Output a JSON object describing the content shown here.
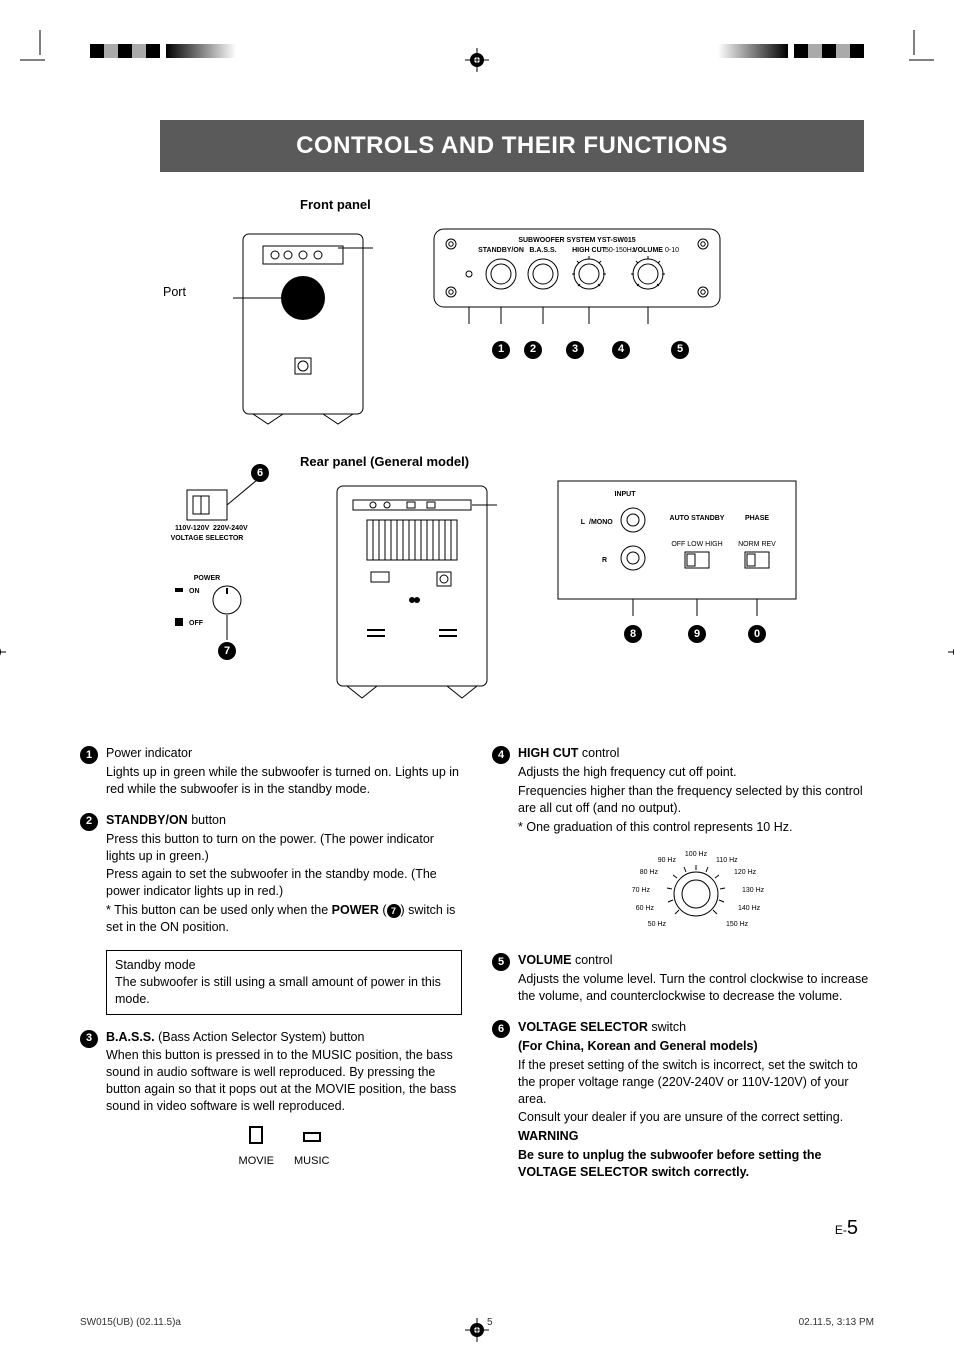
{
  "title": "CONTROLS AND THEIR FUNCTIONS",
  "labels": {
    "front_panel": "Front panel",
    "rear_panel": "Rear panel (General model)",
    "port": "Port"
  },
  "front_panel_zoom": {
    "product": "SUBWOOFER SYSTEM YST-SW015",
    "knob_labels": [
      "STANDBY/ON",
      "B.A.S.S.",
      "HIGH CUT",
      "VOLUME"
    ],
    "high_cut_range": "50-150Hz",
    "volume_range": "0-10"
  },
  "rear_side": {
    "voltage_selector_caption": "VOLTAGE SELECTOR",
    "voltage_left": "110V-120V",
    "voltage_right": "220V-240V",
    "power_label": "POWER",
    "on_label": "ON",
    "off_label": "OFF"
  },
  "rear_panel_zoom": {
    "input_label": "INPUT",
    "mono_label": "/MONO",
    "auto_standby_label": "AUTO STANDBY",
    "auto_standby_opts": "OFF LOW HIGH",
    "phase_label": "PHASE",
    "phase_opts": "NORM REV"
  },
  "callouts_front": [
    "1",
    "2",
    "3",
    "4",
    "5"
  ],
  "callouts_rear_side": [
    "6",
    "7"
  ],
  "callouts_rear_panel": [
    "8",
    "9",
    "0"
  ],
  "items": {
    "1": {
      "title_plain": "Power indicator",
      "body": "Lights up in green while the subwoofer is turned on. Lights up in red while the subwoofer is in the standby mode."
    },
    "2": {
      "title_bold": "STANDBY/ON",
      "title_rest": " button",
      "body1": "Press this button to turn on the power. (The power indicator lights up in green.)",
      "body2": "Press again to set the subwoofer in the standby mode. (The power indicator lights up in red.)",
      "note_pre": "This button can be used only when the ",
      "note_bold": "POWER",
      "note_post1": " (",
      "note_ref": "7",
      "note_post2": ") switch is set in the ON position."
    },
    "standby_box": {
      "title": "Standby mode",
      "body": "The subwoofer is still using a small amount of power in this mode."
    },
    "3": {
      "title_bold": "B.A.S.S.",
      "title_rest": " (Bass Action Selector System) button",
      "body": "When this button is pressed in to the MUSIC position, the bass sound in audio software is well reproduced. By pressing the button again so that it pops out at the MOVIE position, the bass sound in video software is well reproduced.",
      "movie": "MOVIE",
      "music": "MUSIC"
    },
    "4": {
      "title_bold": "HIGH CUT",
      "title_rest": " control",
      "body1": "Adjusts the high frequency cut off point.",
      "body2": "Frequencies higher than the frequency selected by this control are all cut off (and no output).",
      "note": "One graduation of this control represents 10 Hz.",
      "dial_labels": [
        "50 Hz",
        "60 Hz",
        "70 Hz",
        "80 Hz",
        "90 Hz",
        "100 Hz",
        "110 Hz",
        "120 Hz",
        "130 Hz",
        "140 Hz",
        "150 Hz"
      ]
    },
    "5": {
      "title_bold": "VOLUME",
      "title_rest": " control",
      "body": "Adjusts the volume level. Turn the control clockwise to increase the volume, and counterclockwise to decrease the volume."
    },
    "6": {
      "title_bold": "VOLTAGE SELECTOR",
      "title_rest": " switch",
      "sub": "(For China, Korean and General models)",
      "body1": "If the preset setting of the switch is incorrect, set the switch to the proper voltage range (220V-240V or 110V-120V) of your area.",
      "body2": "Consult your dealer if you are unsure of the correct setting.",
      "warn_hdr": "WARNING",
      "warn_body": "Be sure to unplug the subwoofer before setting the VOLTAGE SELECTOR switch correctly."
    }
  },
  "page_number_prefix": "E-",
  "page_number": "5",
  "footer": {
    "left": "SW015(UB)  (02.11.5)a",
    "mid": "5",
    "right": "02.11.5, 3:13 PM"
  }
}
